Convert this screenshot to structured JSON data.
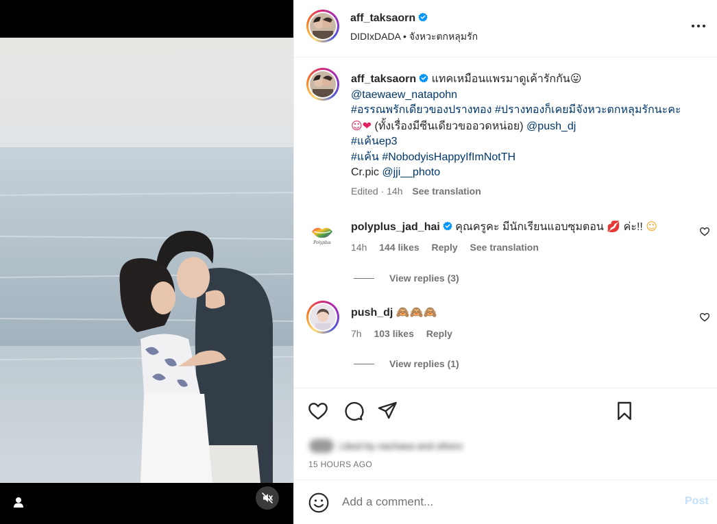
{
  "media": {
    "user_tag_icon": "user-tag-icon",
    "mute_icon": "speaker-muted-icon"
  },
  "header": {
    "username": "aff_taksaorn",
    "verified_icon": "verified-badge-icon",
    "audio": "DIDIxDADA",
    "separator": "•",
    "location": "จังหวะตกหลุมรัก",
    "more_icon": "more-options-icon"
  },
  "caption": {
    "username": "aff_taksaorn",
    "line1": "แทคเหมือนแพรมาดูเค้ารักกัน",
    "line1_emoji": "😛",
    "mention": "@taewaew_natapohn",
    "hashtags1": "#อรรณพรักเดียวของปรางทอง #ปรางทองก็เคยมีจังหวะตกหลุมรักนะคะ",
    "line3_emoji": "☺❤",
    "line3_text": " (ทั้งเรื่องมีซีนเดียวขออวดหน่อย) ",
    "line3_mention": "@push_dj",
    "hashtag_ep": "#แค้นep3",
    "hashtag_a": "#แค้น",
    "hashtag_b": "#NobodyisHappyIfImNotTH",
    "credit_prefix": "Cr.pic ",
    "credit_mention": "@jji__photo",
    "edited": "Edited",
    "dot": "·",
    "time": "14h",
    "see_translation": "See translation"
  },
  "comments": [
    {
      "username": "polyplus_jad_hai",
      "text": "คุณครูคะ มีนักเรียนแอบซุมตอน",
      "emoji_lips": "💋",
      "text_tail": " ค่ะ!! ",
      "emoji_end": "☺",
      "time": "14h",
      "likes": "144 likes",
      "reply": "Reply",
      "see_translation": "See translation",
      "view_replies": "View replies (3)",
      "avatar_text": "Polyplus"
    },
    {
      "username": "push_dj",
      "text": "🙈🙈🙈",
      "time": "7h",
      "likes": "103 likes",
      "reply": "Reply",
      "view_replies": "View replies (1)"
    }
  ],
  "actions": {
    "like_icon": "heart-icon",
    "comment_icon": "comment-icon",
    "share_icon": "share-icon",
    "save_icon": "bookmark-icon",
    "liked_by": "Liked by nachaea and others",
    "timestamp": "15 HOURS AGO"
  },
  "comment_bar": {
    "emoji_icon": "emoji-icon",
    "placeholder": "Add a comment...",
    "post_label": "Post"
  },
  "colors": {
    "link": "#00376b",
    "verified": "#0095f6",
    "secondary_text": "#737373",
    "post_disabled": "#c3e0fb"
  }
}
